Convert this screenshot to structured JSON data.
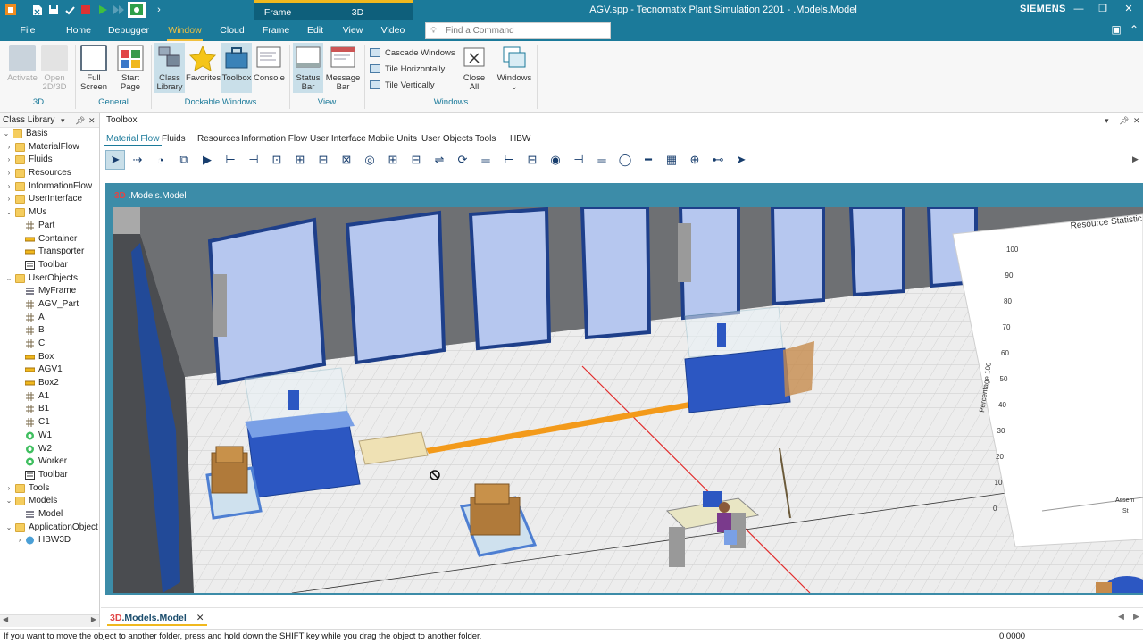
{
  "app": {
    "title": "AGV.spp - Tecnomatix Plant Simulation 2201 - .Models.Model",
    "brand": "SIEMENS"
  },
  "context_tabs": {
    "frame": "Frame",
    "threed": "3D"
  },
  "tabs": [
    {
      "label": "File"
    },
    {
      "label": "Home"
    },
    {
      "label": "Debugger"
    },
    {
      "label": "Window"
    },
    {
      "label": "Cloud"
    },
    {
      "label": "Frame"
    },
    {
      "label": "Edit"
    },
    {
      "label": "View"
    },
    {
      "label": "Video"
    }
  ],
  "search": {
    "placeholder": "Find a Command"
  },
  "ribbon": {
    "activate": "Activate",
    "open2d3d_1": "Open",
    "open2d3d_2": "2D/3D",
    "full_screen_1": "Full",
    "full_screen_2": "Screen",
    "start_page_1": "Start",
    "start_page_2": "Page",
    "class_library_1": "Class",
    "class_library_2": "Library",
    "favorites": "Favorites",
    "toolbox": "Toolbox",
    "console": "Console",
    "status_bar_1": "Status",
    "status_bar_2": "Bar",
    "message_bar_1": "Message",
    "message_bar_2": "Bar",
    "cascade": "Cascade Windows",
    "tile_h": "Tile Horizontally",
    "tile_v": "Tile Vertically",
    "close_all_1": "Close",
    "close_all_2": "All",
    "windows": "Windows",
    "groups": {
      "threed": "3D",
      "general": "General",
      "dockable": "Dockable Windows",
      "view": "View",
      "windows": "Windows"
    }
  },
  "class_library": {
    "title": "Class Library",
    "items": [
      {
        "label": "Basis",
        "depth": 0,
        "exp": "-",
        "icon": "folder"
      },
      {
        "label": "MaterialFlow",
        "depth": 1,
        "exp": "",
        "icon": "folder"
      },
      {
        "label": "Fluids",
        "depth": 1,
        "exp": "",
        "icon": "folder"
      },
      {
        "label": "Resources",
        "depth": 1,
        "exp": "",
        "icon": "folder"
      },
      {
        "label": "InformationFlow",
        "depth": 1,
        "exp": "",
        "icon": "folder"
      },
      {
        "label": "UserInterface",
        "depth": 1,
        "exp": "",
        "icon": "folder"
      },
      {
        "label": "MUs",
        "depth": 1,
        "exp": "",
        "icon": "folder"
      },
      {
        "label": "Part",
        "depth": 2,
        "exp": "",
        "icon": "grid"
      },
      {
        "label": "Container",
        "depth": 2,
        "exp": "",
        "icon": "bar"
      },
      {
        "label": "Transporter",
        "depth": 2,
        "exp": "",
        "icon": "bar"
      },
      {
        "label": "Toolbar",
        "depth": 2,
        "exp": "",
        "icon": "box"
      },
      {
        "label": "UserObjects",
        "depth": 1,
        "exp": "",
        "icon": "folder"
      },
      {
        "label": "MyFrame",
        "depth": 2,
        "exp": "",
        "icon": "frame"
      },
      {
        "label": "AGV_Part",
        "depth": 2,
        "exp": "",
        "icon": "grid"
      },
      {
        "label": "A",
        "depth": 2,
        "exp": "",
        "icon": "grid"
      },
      {
        "label": "B",
        "depth": 2,
        "exp": "",
        "icon": "grid"
      },
      {
        "label": "C",
        "depth": 2,
        "exp": "",
        "icon": "grid"
      },
      {
        "label": "Box",
        "depth": 2,
        "exp": "",
        "icon": "bar"
      },
      {
        "label": "AGV1",
        "depth": 2,
        "exp": "",
        "icon": "bar"
      },
      {
        "label": "Box2",
        "depth": 2,
        "exp": "",
        "icon": "bar"
      },
      {
        "label": "A1",
        "depth": 2,
        "exp": "",
        "icon": "grid"
      },
      {
        "label": "B1",
        "depth": 2,
        "exp": "",
        "icon": "grid"
      },
      {
        "label": "C1",
        "depth": 2,
        "exp": "",
        "icon": "grid"
      },
      {
        "label": "W1",
        "depth": 2,
        "exp": "",
        "icon": "worker"
      },
      {
        "label": "W2",
        "depth": 2,
        "exp": "",
        "icon": "worker"
      },
      {
        "label": "Worker",
        "depth": 2,
        "exp": "",
        "icon": "worker"
      },
      {
        "label": "Toolbar",
        "depth": 2,
        "exp": "",
        "icon": "box"
      },
      {
        "label": "Tools",
        "depth": 1,
        "exp": "",
        "icon": "folder"
      },
      {
        "label": "Models",
        "depth": 1,
        "exp": "",
        "icon": "folder"
      },
      {
        "label": "Model",
        "depth": 2,
        "exp": "",
        "icon": "frame"
      },
      {
        "label": "ApplicationObject",
        "depth": 1,
        "exp": "",
        "icon": "folder"
      },
      {
        "label": "HBW3D",
        "depth": 2,
        "exp": ">",
        "icon": "globe"
      }
    ]
  },
  "toolbox": {
    "title": "Toolbox",
    "tabs": [
      {
        "label": "Material Flow"
      },
      {
        "label": "Fluids"
      },
      {
        "label": "Resources"
      },
      {
        "label": "Information Flow"
      },
      {
        "label": "User Interface"
      },
      {
        "label": "Mobile Units"
      },
      {
        "label": "User Objects"
      },
      {
        "label": "Tools"
      },
      {
        "label": "HBW"
      }
    ]
  },
  "model_window": {
    "tag": "3D",
    "title": ".Models.Model",
    "chart": {
      "title": "Resource Statistic",
      "ylabel": "Percentage 100",
      "yticks": [
        "100",
        "90",
        "80",
        "70",
        "60",
        "50",
        "40",
        "30",
        "20",
        "10",
        "0"
      ],
      "xlabel_1": "Assem",
      "xlabel_2": "St"
    }
  },
  "doc_tab": {
    "tag": "3D",
    "label": ".Models.Model"
  },
  "status": {
    "message": "If you want to move the object to another folder, press and hold down the SHIFT key while you drag the object to another folder.",
    "time": "0.0000"
  },
  "colors": {
    "accent": "#1b7a9a",
    "active_tab": "#f0c040",
    "red_axis": "#e22b2b",
    "conveyor": "#f39a1a"
  }
}
